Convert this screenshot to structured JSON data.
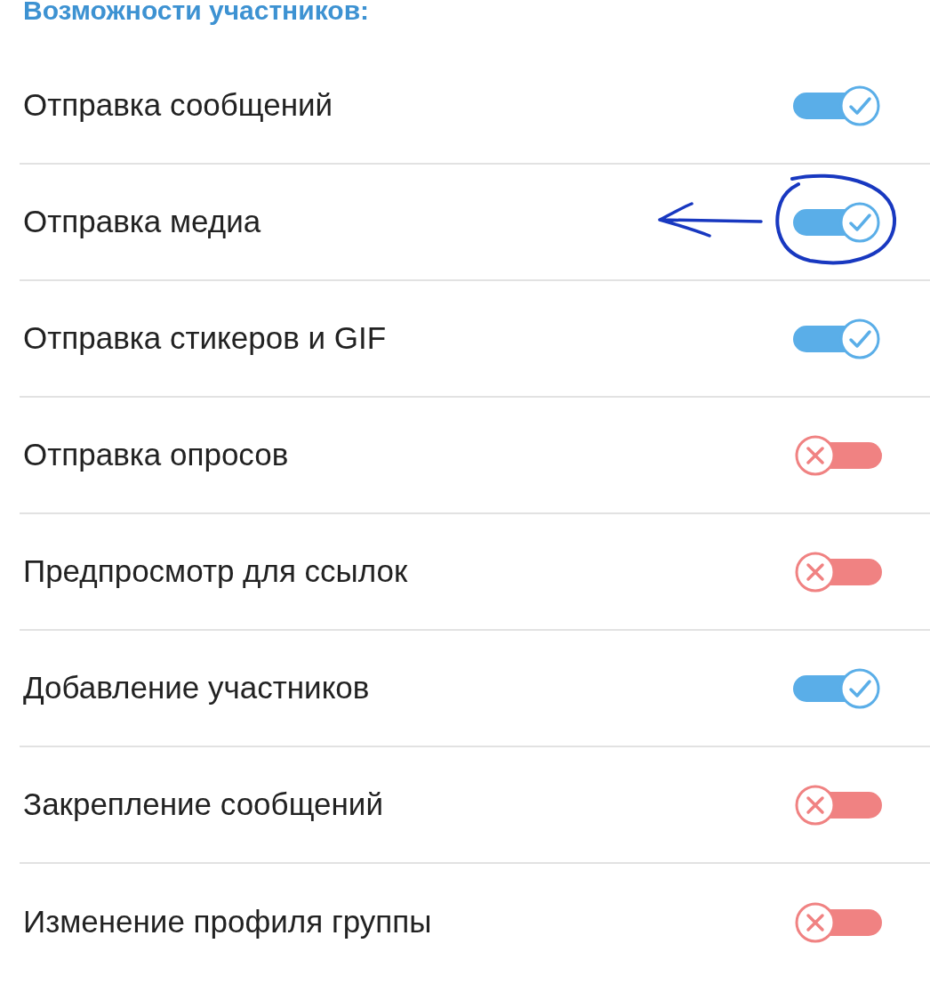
{
  "section_title": "Возможности участников:",
  "rows": [
    {
      "label": "Отправка сообщений",
      "on": true,
      "circled": false
    },
    {
      "label": "Отправка медиа",
      "on": true,
      "circled": true
    },
    {
      "label": "Отправка стикеров и GIF",
      "on": true,
      "circled": false
    },
    {
      "label": "Отправка опросов",
      "on": false,
      "circled": false
    },
    {
      "label": "Предпросмотр для ссылок",
      "on": false,
      "circled": false
    },
    {
      "label": "Добавление участников",
      "on": true,
      "circled": false
    },
    {
      "label": "Закрепление сообщений",
      "on": false,
      "circled": false
    },
    {
      "label": "Изменение профиля группы",
      "on": false,
      "circled": false
    }
  ]
}
